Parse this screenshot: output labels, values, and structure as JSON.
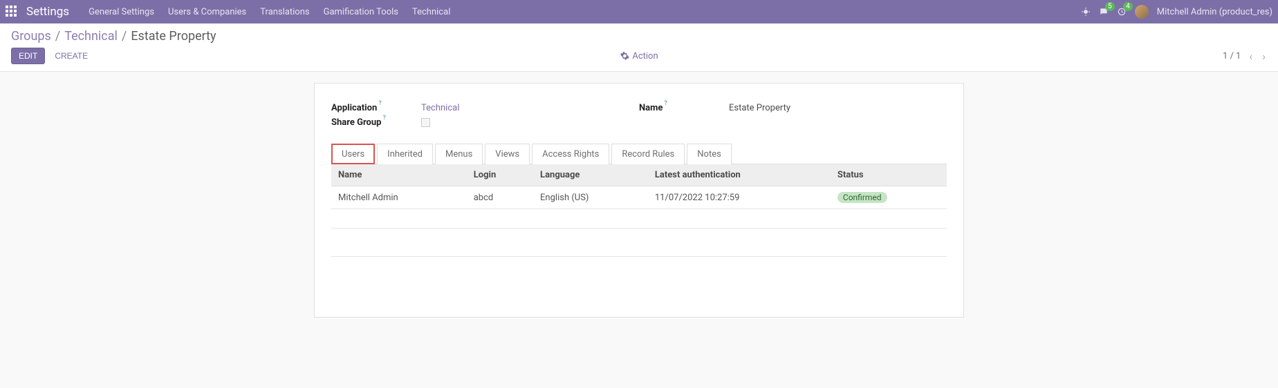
{
  "topbar": {
    "app_name": "Settings",
    "nav": [
      "General Settings",
      "Users & Companies",
      "Translations",
      "Gamification Tools",
      "Technical"
    ],
    "messages_badge": "5",
    "activities_badge": "4",
    "user_label": "Mitchell Admin (product_res)"
  },
  "breadcrumb": {
    "root": "Groups",
    "mid": "Technical",
    "current": "Estate Property"
  },
  "controls": {
    "edit": "EDIT",
    "create": "CREATE",
    "action": "Action",
    "pager": "1 / 1"
  },
  "fields": {
    "application_label": "Application",
    "application_value": "Technical",
    "name_label": "Name",
    "name_value": "Estate Property",
    "share_group_label": "Share Group"
  },
  "tabs": [
    "Users",
    "Inherited",
    "Menus",
    "Views",
    "Access Rights",
    "Record Rules",
    "Notes"
  ],
  "table": {
    "headers": {
      "name": "Name",
      "login": "Login",
      "language": "Language",
      "auth": "Latest authentication",
      "status": "Status"
    },
    "rows": [
      {
        "name": "Mitchell Admin",
        "login": "abcd",
        "language": "English (US)",
        "auth": "11/07/2022 10:27:59",
        "status": "Confirmed"
      }
    ]
  }
}
